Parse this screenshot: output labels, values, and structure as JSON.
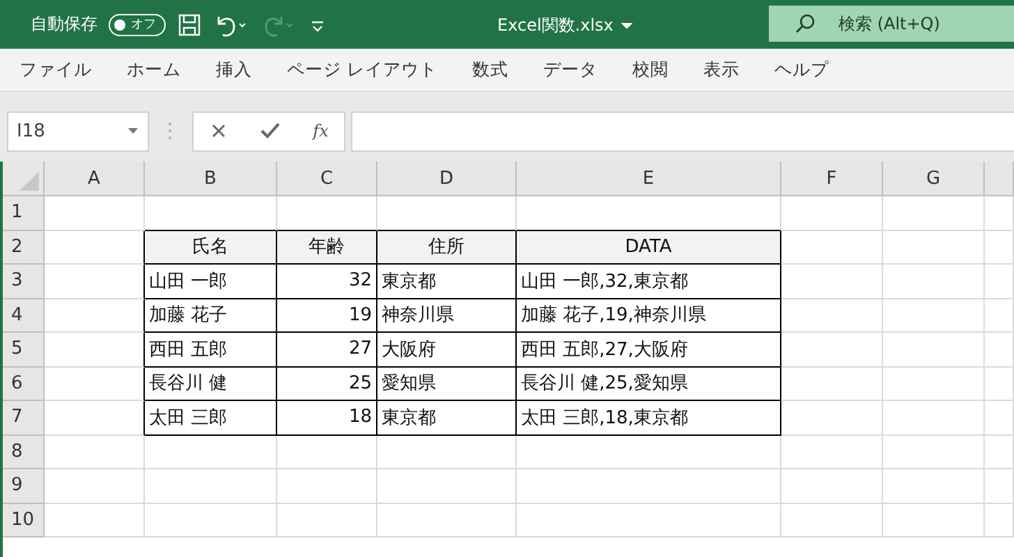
{
  "title_bar": {
    "autosave_label": "自動保存",
    "autosave_toggle": {
      "label": "オフ",
      "on": false
    },
    "file_name": "Excel関数.xlsx",
    "search": {
      "placeholder": "検索 (Alt+Q)"
    }
  },
  "ribbon_tabs": [
    "ファイル",
    "ホーム",
    "挿入",
    "ページ レイアウト",
    "数式",
    "データ",
    "校閲",
    "表示",
    "ヘルプ"
  ],
  "formula_bar": {
    "name_box": "I18",
    "function_button": "fx"
  },
  "sheet": {
    "columns": [
      "A",
      "B",
      "C",
      "D",
      "E",
      "F",
      "G"
    ],
    "rows": [
      "1",
      "2",
      "3",
      "4",
      "5",
      "6",
      "7",
      "8",
      "9",
      "10"
    ],
    "table": {
      "header": [
        {
          "label": "氏名",
          "kind": "text"
        },
        {
          "label": "年齢",
          "kind": "number"
        },
        {
          "label": "住所",
          "kind": "text"
        },
        {
          "label": "DATA",
          "kind": "text"
        }
      ],
      "rows": [
        [
          "山田 一郎",
          "32",
          "東京都",
          "山田 一郎,32,東京都"
        ],
        [
          "加藤 花子",
          "19",
          "神奈川県",
          "加藤 花子,19,神奈川県"
        ],
        [
          "西田 五郎",
          "27",
          "大阪府",
          "西田 五郎,27,大阪府"
        ],
        [
          "長谷川 健",
          "25",
          "愛知県",
          "長谷川 健,25,愛知県"
        ],
        [
          "太田 三郎",
          "18",
          "東京都",
          "太田 三郎,18,東京都"
        ]
      ]
    }
  }
}
